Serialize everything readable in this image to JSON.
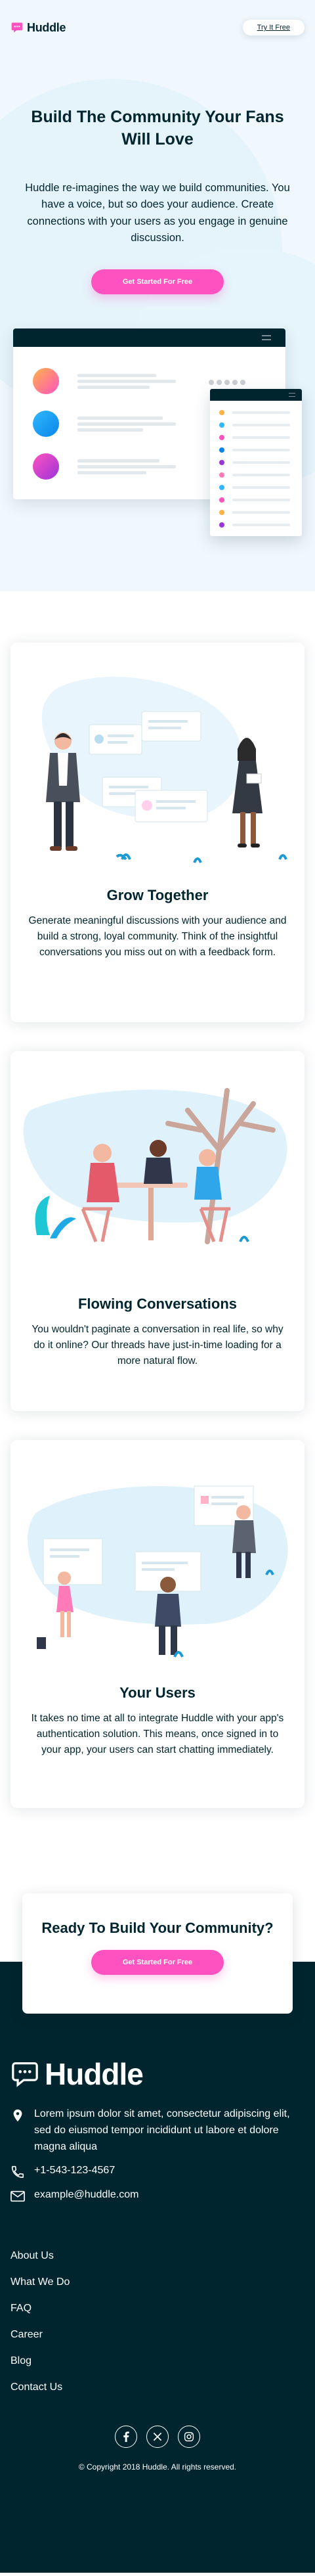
{
  "header": {
    "logo_text": "Huddle",
    "try_button": "Try It Free"
  },
  "hero": {
    "title": "Build The Community Your Fans Will Love",
    "text": "Huddle re-imagines the way we build communities. You have a voice, but so does your audience. Create connections with your users as you engage in genuine discussion.",
    "cta": "Get Started For Free"
  },
  "features": [
    {
      "title": "Grow Together",
      "text": "Generate meaningful discussions with your audience and build a strong, loyal community. Think of the insightful conversations you miss out on with a feedback form."
    },
    {
      "title": "Flowing Conversations",
      "text": "You wouldn't paginate a conversation in real life, so why do it online? Our threads have just-in-time loading for a more natural flow."
    },
    {
      "title": "Your Users",
      "text": "It takes no time at all to integrate Huddle with your app's authentication solution. This means, once signed in to your app, your users can start chatting immediately."
    }
  ],
  "cta_card": {
    "title": "Ready To Build Your Community?",
    "button": "Get Started For Free"
  },
  "footer": {
    "logo_text": "Huddle",
    "address": "Lorem ipsum dolor sit amet, consectetur adipiscing elit, sed do eiusmod tempor incididunt ut labore et dolore magna aliqua",
    "phone": "+1-543-123-4567",
    "email": "example@huddle.com",
    "links": [
      "About Us",
      "What We Do",
      "FAQ",
      "Career",
      "Blog",
      "Contact Us"
    ],
    "copyright": "© Copyright 2018 Huddle. All rights reserved."
  },
  "colors": {
    "pink": "#ff52c1",
    "dark_cyan": "#00252e",
    "pale_blue": "#f0f8fd"
  },
  "icons": [
    "chat-bubble-icon",
    "location-icon",
    "phone-icon",
    "email-icon",
    "facebook-icon",
    "x-twitter-icon",
    "instagram-icon",
    "menu-icon"
  ]
}
